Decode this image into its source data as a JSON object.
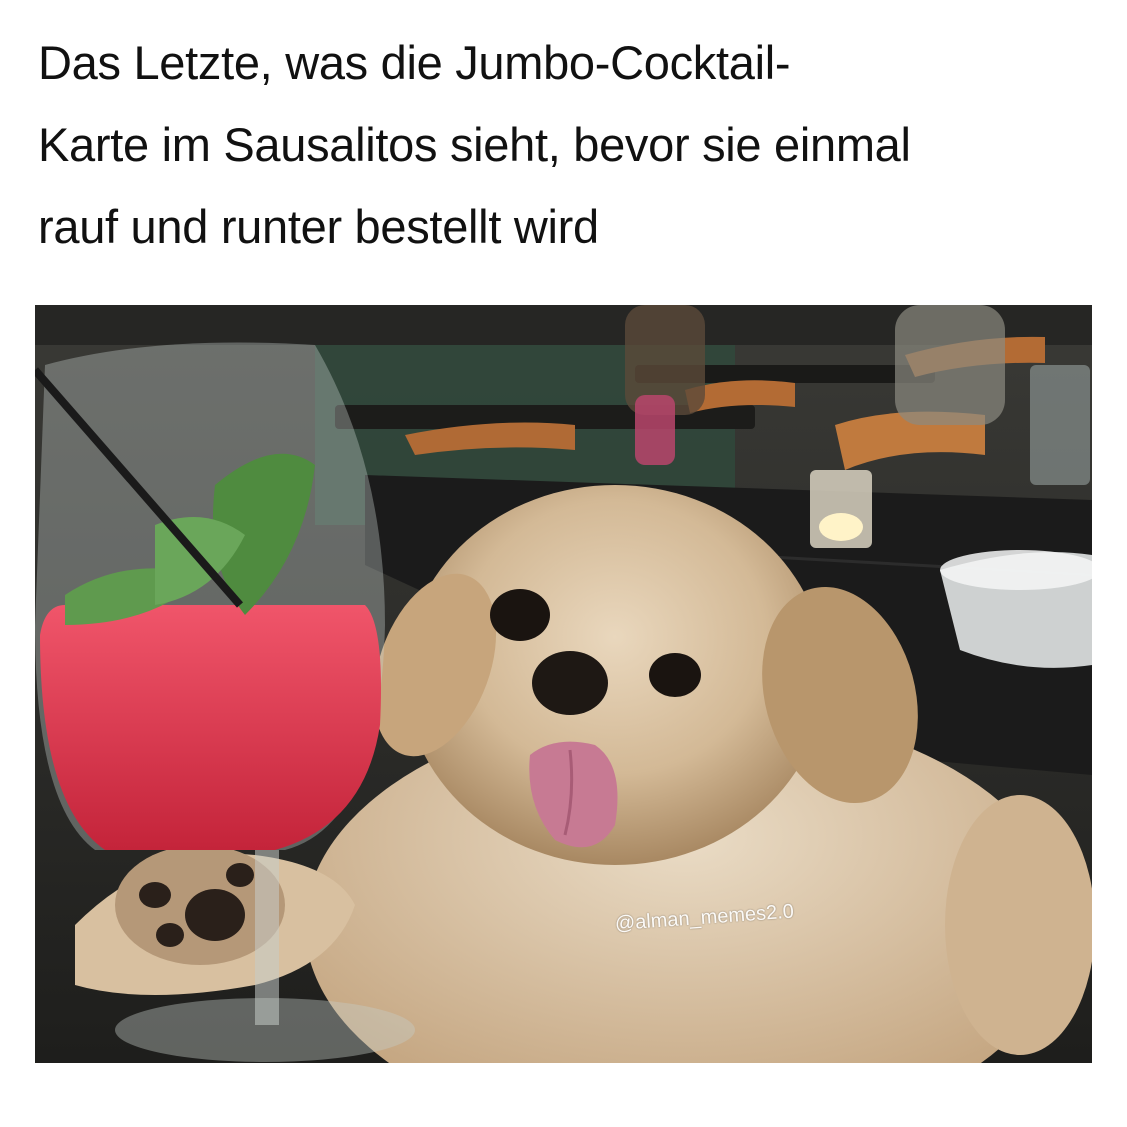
{
  "caption": {
    "line1": "Das Letzte, was die Jumbo-Cocktail-",
    "line2": "Karte im Sausalitos sieht, bevor sie einmal",
    "line3": "rauf und runter bestellt wird"
  },
  "photo": {
    "watermark": "@alman_memes2.0",
    "colors": {
      "cocktail": "#e2384f",
      "dog_fur": "#d8bfa0",
      "table": "#1d1d1d"
    }
  }
}
